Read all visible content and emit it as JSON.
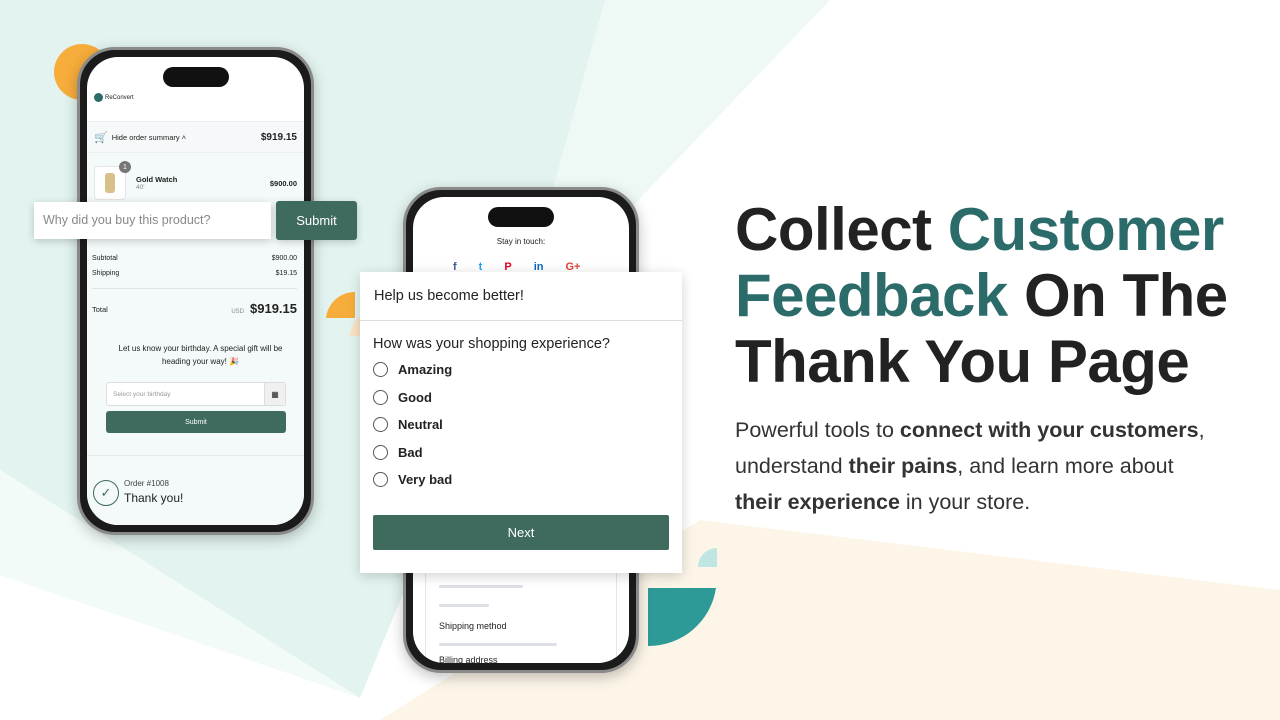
{
  "colors": {
    "accent": "#2b6b69",
    "button": "#3f6b5e",
    "orange": "#f7ad3b",
    "teal_deco": "#2e9a98"
  },
  "phone_left": {
    "brand": "ReConvert",
    "summary_toggle": "Hide order summary",
    "summary_total": "$919.15",
    "item": {
      "qty": "1",
      "name": "Gold Watch",
      "variant": "40'",
      "price": "$900.00"
    },
    "subtotal_label": "Subtotal",
    "subtotal": "$900.00",
    "shipping_label": "Shipping",
    "shipping": "$19.15",
    "total_label": "Total",
    "currency": "USD",
    "total": "$919.15",
    "birthday_text": "Let us know your birthday. A special gift will be heading your way! 🎉",
    "birthday_placeholder": "Select your birthday",
    "birthday_submit": "Submit",
    "order_number": "Order #1008",
    "thank_you": "Thank you!"
  },
  "feedback_widget": {
    "placeholder": "Why did you buy this product?",
    "submit": "Submit"
  },
  "phone_mid": {
    "stay_in_touch": "Stay in touch:",
    "social_icons": [
      "facebook",
      "twitter",
      "pinterest",
      "linkedin",
      "google-plus"
    ],
    "shipping_method": "Shipping method",
    "billing_address": "Billing address"
  },
  "survey": {
    "title": "Help us become better!",
    "question": "How was your shopping experience?",
    "options": [
      "Amazing",
      "Good",
      "Neutral",
      "Bad",
      "Very bad"
    ],
    "next": "Next"
  },
  "hero": {
    "line1a": "Collect ",
    "line1b": "Customer",
    "line2a": "Feedback",
    "line2b": " On The",
    "line3": "Thank You Page",
    "p1a": "Powerful tools to ",
    "p1b": "connect with your customers",
    ",": ",",
    "p2a": "understand ",
    "p2b": "their pains",
    "p2c": ", and learn more about",
    "p3a": "their experience",
    "p3b": " in your store."
  }
}
